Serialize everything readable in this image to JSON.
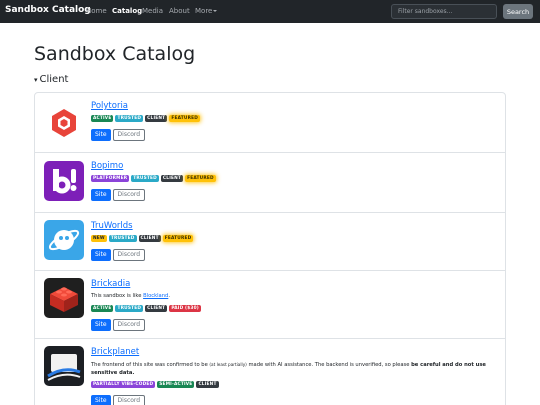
{
  "navbar": {
    "brand": "Sandbox Catalog",
    "links": [
      "Home",
      "Catalog",
      "Media",
      "About",
      "More"
    ],
    "search_placeholder": "Filter sandboxes...",
    "search_button": "Search"
  },
  "page": {
    "title": "Sandbox Catalog",
    "section": "Client",
    "section_marker": "▾"
  },
  "items": [
    {
      "name": "Polytoria",
      "badges": [
        "ACTIVE",
        "TRUSTED",
        "CLIENT",
        "FEATURED"
      ],
      "buttons": [
        "Site",
        "Discord"
      ]
    },
    {
      "name": "Bopimo",
      "badges": [
        "PLATFORMER",
        "TRUSTED",
        "CLIENT",
        "FEATURED"
      ],
      "buttons": [
        "Site",
        "Discord"
      ]
    },
    {
      "name": "TruWorlds",
      "badges": [
        "NEW",
        "TRUSTED",
        "CLIENT",
        "FEATURED"
      ],
      "buttons": [
        "Site",
        "Discord"
      ]
    },
    {
      "name": "Brickadia",
      "description_prefix": "This sandbox is like ",
      "description_link": "Blockland",
      "description_suffix": ".",
      "badges": [
        "ACTIVE",
        "TRUSTED",
        "CLIENT",
        "PAID ($30)"
      ],
      "buttons": [
        "Site",
        "Discord"
      ]
    },
    {
      "name": "Brickplanet",
      "description_1": "The frontend of this site was confirmed to be ",
      "description_small": "(at least partially)",
      "description_2": " made with AI assistance. The backend is unverified, so please ",
      "description_bold": "be careful and do not use sensitive data.",
      "badges": [
        "PARTIALLY VIBE-CODED",
        "SEMI-ACTIVE",
        "CLIENT"
      ],
      "buttons": [
        "Site",
        "Discord"
      ]
    }
  ],
  "colors": {
    "navbar_bg": "#212529",
    "link": "#0d6efd",
    "active_badge": "#198754",
    "trusted_badge": "#2aa9c7",
    "client_badge": "#343a40",
    "featured_badge": "#ffc107",
    "platformer_badge": "#8b44d9",
    "paid_badge": "#dc3545"
  },
  "icons": [
    "polytoria-logo",
    "bopimo-logo",
    "truworlds-logo",
    "brickadia-logo",
    "brickplanet-logo"
  ]
}
